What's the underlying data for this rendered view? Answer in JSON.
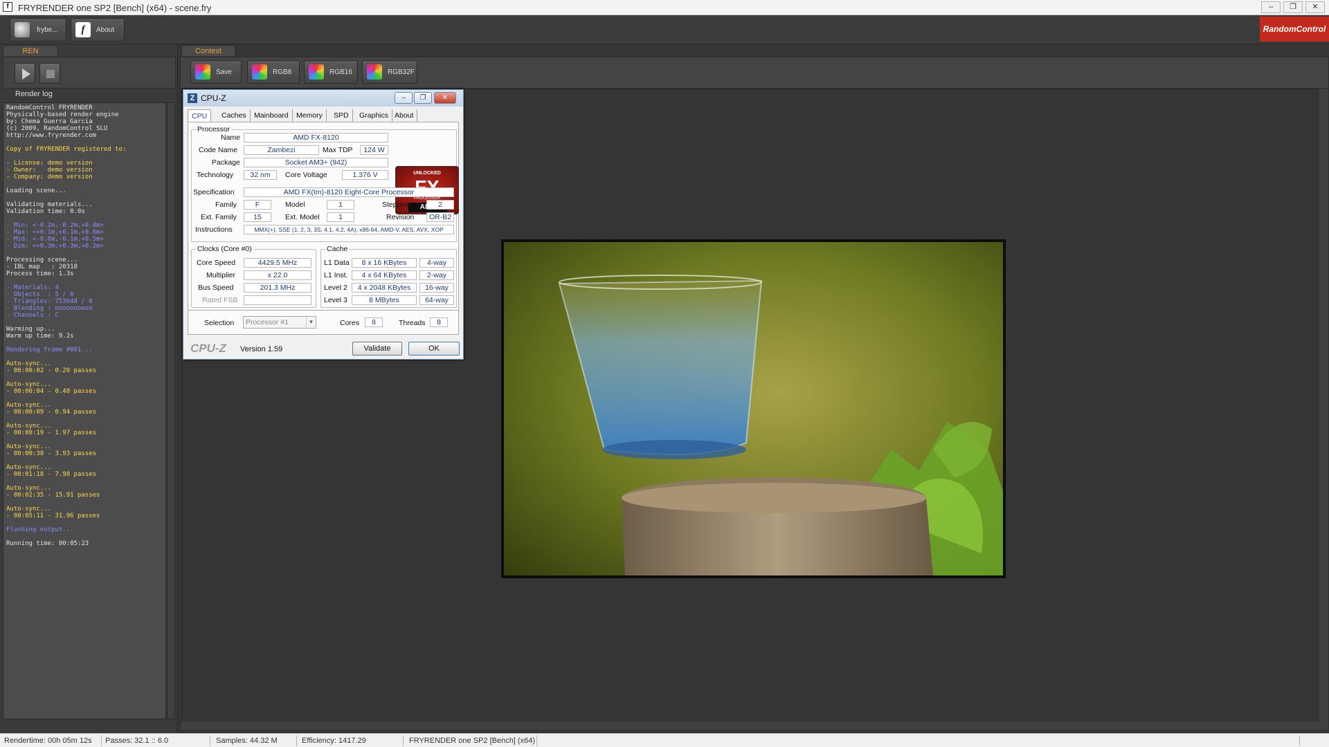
{
  "window": {
    "title": "FRYRENDER one SP2 [Bench] (x64) - scene.fry",
    "app_icon_letter": "f",
    "controls": {
      "minimize": "–",
      "maximize": "❐",
      "close": "✕"
    }
  },
  "toolbar": {
    "frybench_label": "frybe...",
    "about_label": "About",
    "brand": "RandomControl"
  },
  "left_panel": {
    "tab": "REN",
    "log_title": "Render log",
    "log_lines": [
      {
        "t": "RandomControl FRYRENDER",
        "c": "#e6e6e6"
      },
      {
        "t": "Physically-based render engine",
        "c": "#e6e6e6"
      },
      {
        "t": "by: Chema Guerra Garcia",
        "c": "#e6e6e6"
      },
      {
        "t": "(c) 2009, RandomControl SLU",
        "c": "#e6e6e6"
      },
      {
        "t": "http://www.fryrender.com",
        "c": "#e6e6e6"
      },
      {
        "t": "",
        "c": "#e6e6e6"
      },
      {
        "t": "Copy of FRYRENDER registered to:",
        "c": "#ffd84a"
      },
      {
        "t": "",
        "c": "#e6e6e6"
      },
      {
        "t": "- License: demo version",
        "c": "#ffd84a"
      },
      {
        "t": "- Owner:   demo version",
        "c": "#ffd84a"
      },
      {
        "t": "- Company: demo version",
        "c": "#ffd84a"
      },
      {
        "t": "",
        "c": "#e6e6e6"
      },
      {
        "t": "Loading scene...",
        "c": "#e6e6e6"
      },
      {
        "t": "",
        "c": "#e6e6e6"
      },
      {
        "t": "Validating materials...",
        "c": "#e6e6e6"
      },
      {
        "t": "Validation time: 0.0s",
        "c": "#e6e6e6"
      },
      {
        "t": "",
        "c": "#e6e6e6"
      },
      {
        "t": "- Min: <-0.2m,-0.2m,+0.4m>",
        "c": "#8c8cff"
      },
      {
        "t": "- Max: <+0.1m,+0.1m,+0.6m>",
        "c": "#8c8cff"
      },
      {
        "t": "- Mid: <-0.0m,-0.1m,+0.5m>",
        "c": "#8c8cff"
      },
      {
        "t": "- Dim: <+0.3m,+0.3m,+0.2m>",
        "c": "#8c8cff"
      },
      {
        "t": "",
        "c": "#e6e6e6"
      },
      {
        "t": "Processing scene...",
        "c": "#e6e6e6"
      },
      {
        "t": "- IBL map   : 20318",
        "c": "#e6e6e6"
      },
      {
        "t": "Process time: 1.3s",
        "c": "#e6e6e6"
      },
      {
        "t": "",
        "c": "#e6e6e6"
      },
      {
        "t": "- Materials: 4",
        "c": "#8c8cff"
      },
      {
        "t": "- Objects  : 5 / 0",
        "c": "#8c8cff"
      },
      {
        "t": "- Triangles: 753648 / 0",
        "c": "#8c8cff"
      },
      {
        "t": "- Blending : oooooooooo",
        "c": "#8c8cff"
      },
      {
        "t": "- Channels : C",
        "c": "#8c8cff"
      },
      {
        "t": "",
        "c": "#e6e6e6"
      },
      {
        "t": "Warming up...",
        "c": "#e6e6e6"
      },
      {
        "t": "Warm up time: 9.2s",
        "c": "#e6e6e6"
      },
      {
        "t": "",
        "c": "#e6e6e6"
      },
      {
        "t": "Rendering frame #001...",
        "c": "#8c8cff"
      },
      {
        "t": "",
        "c": "#e6e6e6"
      },
      {
        "t": "Auto-sync...",
        "c": "#ffd84a"
      },
      {
        "t": "- 00:00:02 - 0.20 passes",
        "c": "#ffd84a"
      },
      {
        "t": "",
        "c": "#e6e6e6"
      },
      {
        "t": "Auto-sync...",
        "c": "#ffd84a"
      },
      {
        "t": "- 00:00:04 - 0.40 passes",
        "c": "#ffd84a"
      },
      {
        "t": "",
        "c": "#e6e6e6"
      },
      {
        "t": "Auto-sync...",
        "c": "#ffd84a"
      },
      {
        "t": "- 00:00:09 - 0.94 passes",
        "c": "#ffd84a"
      },
      {
        "t": "",
        "c": "#e6e6e6"
      },
      {
        "t": "Auto-sync...",
        "c": "#ffd84a"
      },
      {
        "t": "- 00:00:19 - 1.97 passes",
        "c": "#ffd84a"
      },
      {
        "t": "",
        "c": "#e6e6e6"
      },
      {
        "t": "Auto-sync...",
        "c": "#ffd84a"
      },
      {
        "t": "- 00:00:38 - 3.93 passes",
        "c": "#ffd84a"
      },
      {
        "t": "",
        "c": "#e6e6e6"
      },
      {
        "t": "Auto-sync...",
        "c": "#ffd84a"
      },
      {
        "t": "- 00:01:18 - 7.98 passes",
        "c": "#ffd84a"
      },
      {
        "t": "",
        "c": "#e6e6e6"
      },
      {
        "t": "Auto-sync...",
        "c": "#ffd84a"
      },
      {
        "t": "- 00:02:35 - 15.91 passes",
        "c": "#ffd84a"
      },
      {
        "t": "",
        "c": "#e6e6e6"
      },
      {
        "t": "Auto-sync...",
        "c": "#ffd84a"
      },
      {
        "t": "- 00:05:11 - 31.96 passes",
        "c": "#ffd84a"
      },
      {
        "t": "",
        "c": "#e6e6e6"
      },
      {
        "t": "Flushing output...",
        "c": "#8c8cff"
      },
      {
        "t": "",
        "c": "#e6e6e6"
      },
      {
        "t": "Running time: 00:05:23",
        "c": "#e6e6e6"
      }
    ]
  },
  "context": {
    "tab": "Context",
    "buttons": {
      "save": "Save",
      "rgb8": "RGB8",
      "rgb16": "RGB16",
      "rgb32f": "RGB32F"
    }
  },
  "cpuz": {
    "title": "CPU-Z",
    "tabs": [
      "CPU",
      "Caches",
      "Mainboard",
      "Memory",
      "SPD",
      "Graphics",
      "About"
    ],
    "active_tab": "CPU",
    "processor": {
      "group": "Processor",
      "name_label": "Name",
      "name": "AMD FX-8120",
      "codename_label": "Code Name",
      "codename": "Zambezi",
      "maxtdp_label": "Max TDP",
      "maxtdp": "124 W",
      "package_label": "Package",
      "package": "Socket AM3+ (942)",
      "technology_label": "Technology",
      "technology": "32 nm",
      "corevoltage_label": "Core Voltage",
      "corevoltage": "1.376 V",
      "spec_label": "Specification",
      "spec": "AMD FX(tm)-8120 Eight-Core Processor",
      "family_label": "Family",
      "family": "F",
      "model_label": "Model",
      "model": "1",
      "stepping_label": "Stepping",
      "stepping": "2",
      "extfamily_label": "Ext. Family",
      "extfamily": "15",
      "extmodel_label": "Ext. Model",
      "extmodel": "1",
      "revision_label": "Revision",
      "revision": "OR-B2",
      "instructions_label": "Instructions",
      "instructions": "MMX(+), SSE (1, 2, 3, 3S, 4.1, 4.2, 4A), x86-64, AMD-V, AES, AVX, XOP"
    },
    "logo": {
      "unlocked": "UNLOCKED",
      "fx": "FX",
      "processor": "PROCESSOR",
      "amd": "AMD"
    },
    "clocks": {
      "group": "Clocks (Core #0)",
      "corespeed_label": "Core Speed",
      "corespeed": "4429.5 MHz",
      "multiplier_label": "Multiplier",
      "multiplier": "x 22.0",
      "busspeed_label": "Bus Speed",
      "busspeed": "201.3 MHz",
      "ratedfsb_label": "Rated FSB",
      "ratedfsb": ""
    },
    "cache": {
      "group": "Cache",
      "l1d_label": "L1 Data",
      "l1d": "8 x 16 KBytes",
      "l1d_way": "4-way",
      "l1i_label": "L1 Inst.",
      "l1i": "4 x 64 KBytes",
      "l1i_way": "2-way",
      "l2_label": "Level 2",
      "l2": "4 x 2048 KBytes",
      "l2_way": "16-way",
      "l3_label": "Level 3",
      "l3": "8 MBytes",
      "l3_way": "64-way"
    },
    "selection_label": "Selection",
    "selection": "Processor #1",
    "cores_label": "Cores",
    "cores": "8",
    "threads_label": "Threads",
    "threads": "8",
    "footer_brand": "CPU-Z",
    "version": "Version 1.59",
    "validate": "Validate",
    "ok": "OK"
  },
  "status": {
    "rendertime": "Rendertime:  00h 05m 12s",
    "passes": "Passes:  32.1 :: 6.0",
    "samples": "Samples:  44.32 M",
    "efficiency": "Efficiency:  1417.29",
    "product": "FRYRENDER one SP2 [Bench] (x64)"
  }
}
